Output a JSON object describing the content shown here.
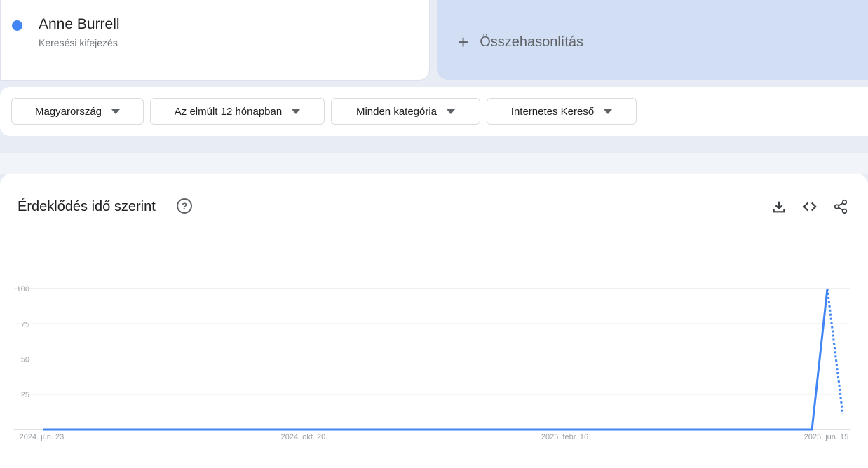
{
  "term": {
    "name": "Anne Burrell",
    "type": "Keresési kifejezés",
    "color": "#4285f4"
  },
  "compare": {
    "label": "Összehasonlítás"
  },
  "filters": [
    "Magyarország",
    "Az elmúlt 12 hónapban",
    "Minden kategória",
    "Internetes Kereső"
  ],
  "chart_section": {
    "title": "Érdeklődés idő szerint",
    "help": "?",
    "actions": [
      "download-icon",
      "embed-icon",
      "share-icon"
    ]
  },
  "chart_data": {
    "type": "line",
    "title": "Érdeklődés idő szerint",
    "ylim": [
      0,
      100
    ],
    "yticks": [
      "100",
      "75",
      "50",
      "25"
    ],
    "xticks": [
      "2024. jún. 23.",
      "2024. okt. 20.",
      "2025. febr. 16.",
      "2025. jún. 15."
    ],
    "x_start": "2024-06-23",
    "x_step": "week",
    "values": [
      0,
      0,
      0,
      0,
      0,
      0,
      0,
      0,
      0,
      0,
      0,
      0,
      0,
      0,
      0,
      0,
      0,
      0,
      0,
      0,
      0,
      0,
      0,
      0,
      0,
      0,
      0,
      0,
      0,
      0,
      0,
      0,
      0,
      0,
      0,
      0,
      0,
      0,
      0,
      0,
      0,
      0,
      0,
      0,
      0,
      0,
      0,
      0,
      0,
      0,
      0,
      100
    ],
    "partial_value": 11,
    "series_color": "#4285f4"
  }
}
